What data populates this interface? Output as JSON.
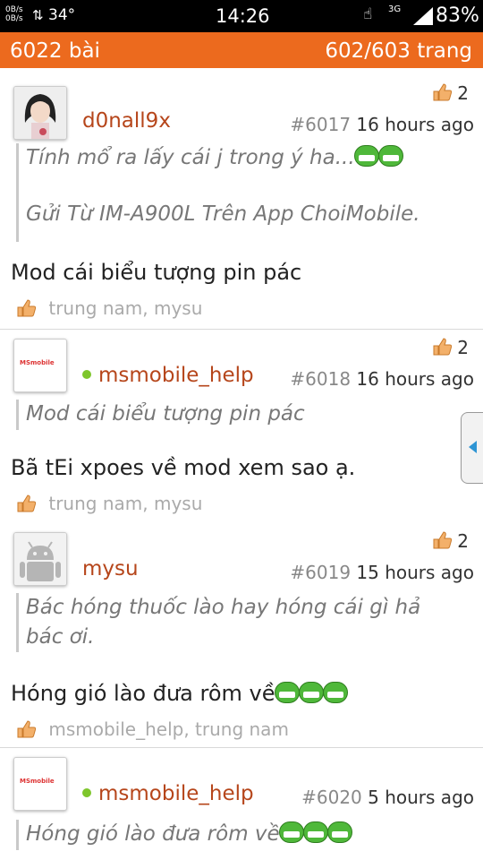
{
  "status_bar": {
    "net_up": "0B/s",
    "net_down": "0B/s",
    "temperature": "34°",
    "time": "14:26",
    "network": "3G",
    "battery": "83%"
  },
  "topbar": {
    "post_count": "6022 bài",
    "page_info": "602/603 trang"
  },
  "icons": {
    "thumb": "thumbs-up-icon",
    "emoticon": "grin-emoticon-icon",
    "sidetab": "chevron-left-icon"
  },
  "colors": {
    "accent": "#ec6a1e",
    "username": "#b6461b",
    "online": "#7ec62c",
    "sidetab_arrow": "#2e95d4"
  },
  "posts": [
    {
      "username": "d0nall9x",
      "likes": "2",
      "post_number": "#6017",
      "time": "16 hours ago",
      "quote_line1": "Tính mổ ra lấy cái j trong ý ha...",
      "quote_line2": "Gửi Từ IM-A900L Trên App ChoiMobile.",
      "body": "Mod cái biểu tượng pin pác",
      "likers": "trung nam, mysu"
    },
    {
      "username": "msmobile_help",
      "avatar_text": "MSmobile",
      "likes": "2",
      "post_number": "#6018",
      "time": "16 hours ago",
      "quote_line1": "Mod cái biểu tượng pin pác",
      "body": "Bã tEi xpoes về mod xem sao ạ.",
      "likers": "trung nam, mysu"
    },
    {
      "username": "mysu",
      "likes": "2",
      "post_number": "#6019",
      "time": "15 hours ago",
      "quote_line1": "Bác hóng thuốc lào hay hóng cái gì hả",
      "quote_line2": "bác ơi.",
      "body": "Hóng gió lào đưa rôm về",
      "likers": "msmobile_help, trung nam"
    },
    {
      "username": "msmobile_help",
      "avatar_text": "MSmobile",
      "post_number": "#6020",
      "time": "5 hours ago",
      "quote_line1": "Hóng gió lào đưa rôm về"
    }
  ]
}
